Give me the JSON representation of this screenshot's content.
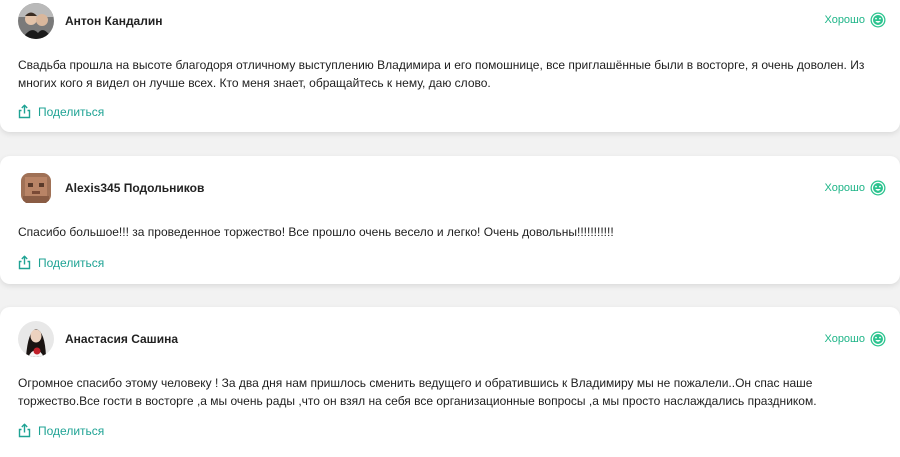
{
  "reviews": [
    {
      "author": "Антон Кандалин",
      "rating_label": "Хорошо",
      "text": "Свадьба прошла на высоте благодоря отличному выступлению Владимира и его помошнице, все приглашённые были в восторге, я очень доволен. Из многих кого я видел он лучше всех. Кто меня знает, обращайтесь к нему, даю слово.",
      "share_label": "Поделиться"
    },
    {
      "author": "Alexis345 Подольников",
      "rating_label": "Хорошо",
      "text": "Спасибо большое!!! за проведенное торжество! Все прошло очень весело и легко! Очень довольны!!!!!!!!!!!",
      "share_label": "Поделиться"
    },
    {
      "author": "Анастасия Сашина",
      "rating_label": "Хорошо",
      "text": "Огромное спасибо этому человеку ! За два дня нам пришлось сменить ведущего и обратившись к Владимиру мы не пожалели..Он спас наше торжество.Все гости в восторге ,а мы очень рады ,что он взял на себя все организационные вопросы ,а мы просто наслаждались праздником.",
      "share_label": "Поделиться"
    }
  ],
  "colors": {
    "accent": "#1fb588",
    "share": "#1fa394",
    "background": "#f2f2f2"
  }
}
